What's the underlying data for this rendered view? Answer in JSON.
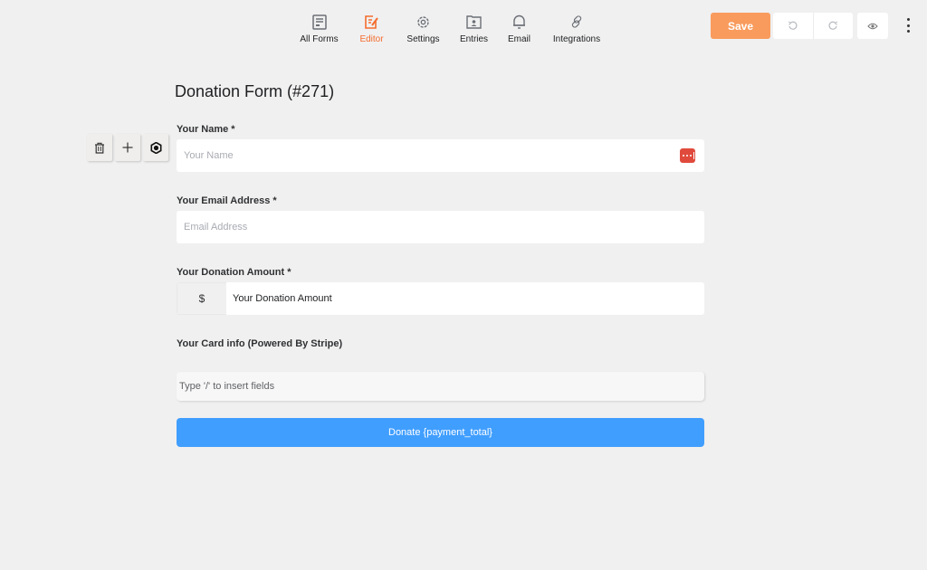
{
  "nav": {
    "items": [
      {
        "label": "All Forms",
        "icon": "list-icon",
        "active": false
      },
      {
        "label": "Editor",
        "icon": "edit-icon",
        "active": true
      },
      {
        "label": "Settings",
        "icon": "gear-icon",
        "active": false
      },
      {
        "label": "Entries",
        "icon": "contact-card-icon",
        "active": false
      },
      {
        "label": "Email",
        "icon": "bell-icon",
        "active": false
      },
      {
        "label": "Integrations",
        "icon": "link-icon",
        "active": false
      }
    ]
  },
  "toolbar": {
    "save_label": "Save",
    "accent_color": "#f99b5d",
    "undo_icon": "undo-icon",
    "redo_icon": "redo-icon",
    "preview_icon": "eye-icon",
    "more_icon": "kebab-menu-icon"
  },
  "form": {
    "title": "Donation Form (#271)",
    "field_tools": [
      "trash-icon",
      "plus-icon",
      "settings-icon"
    ],
    "fields": {
      "name": {
        "label": "Your Name *",
        "placeholder": "Your Name"
      },
      "email": {
        "label": "Your Email Address *",
        "placeholder": "Email Address"
      },
      "amount": {
        "label": "Your Donation Amount *",
        "prefix": "$",
        "value": "Your Donation Amount"
      },
      "card": {
        "label": "Your Card info (Powered By Stripe)"
      }
    },
    "insert_hint": "Type '/' to insert fields",
    "submit_label": "Donate {payment_total}",
    "submit_color": "#409eff"
  }
}
